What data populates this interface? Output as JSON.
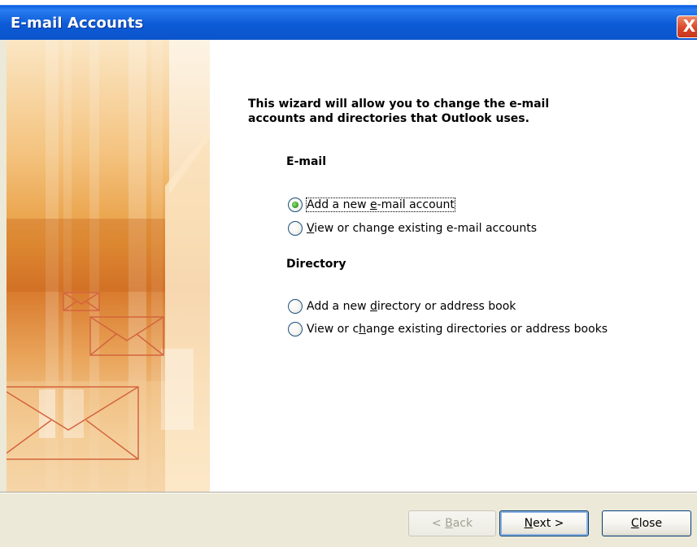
{
  "window": {
    "title": "E-mail Accounts",
    "close_glyph": "X"
  },
  "intro": {
    "line1": "This wizard will allow you to change the e-mail",
    "line2": "accounts and directories that Outlook uses."
  },
  "email_section": {
    "heading": "E-mail",
    "options": [
      {
        "label_pre": "Add a new ",
        "accel": "e",
        "label_post": "-mail account",
        "checked": true
      },
      {
        "label_pre": "",
        "accel": "V",
        "label_post": "iew or change existing e-mail accounts",
        "checked": false
      }
    ]
  },
  "directory_section": {
    "heading": "Directory",
    "options": [
      {
        "label_pre": "Add a new ",
        "accel": "d",
        "label_post": "irectory or address book",
        "checked": false
      },
      {
        "label_pre": "View or c",
        "accel": "h",
        "label_post": "ange existing directories or address books",
        "checked": false
      }
    ]
  },
  "buttons": {
    "back": {
      "pre": "< ",
      "accel": "B",
      "post": "ack",
      "enabled": false
    },
    "next": {
      "pre": "",
      "accel": "N",
      "post": "ext >",
      "enabled": true
    },
    "close": {
      "pre": "",
      "accel": "C",
      "post": "lose",
      "enabled": true
    }
  },
  "icons": {
    "close": "close-icon",
    "banner": "envelope-banner-art"
  },
  "colors": {
    "titlebar": "#0b55cc",
    "dialog_face": "#ece9d8",
    "radio_checked": "#3ca32a",
    "banner_orange": "#d8792b"
  }
}
